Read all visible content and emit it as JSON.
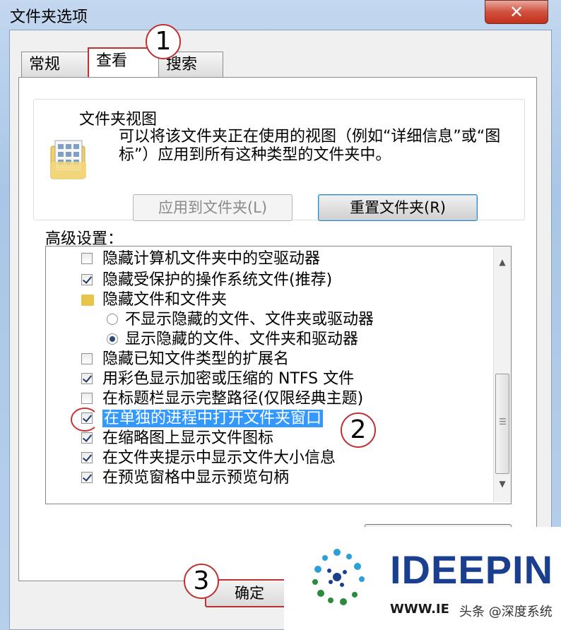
{
  "window": {
    "title": "文件夹选项",
    "close_glyph": "✕"
  },
  "tabs": [
    {
      "label": "常规"
    },
    {
      "label": "查看"
    },
    {
      "label": "搜索"
    }
  ],
  "folder_view": {
    "group_title": "文件夹视图",
    "description": "可以将该文件夹正在使用的视图（例如“详细信息”或“图标”）应用到所有这种类型的文件夹中。",
    "apply_button": "应用到文件夹(L)",
    "reset_button": "重置文件夹(R)"
  },
  "advanced": {
    "label": "高级设置：",
    "items": [
      {
        "type": "checkbox",
        "checked": false,
        "label": "隐藏计算机文件夹中的空驱动器"
      },
      {
        "type": "checkbox",
        "checked": true,
        "label": "隐藏受保护的操作系统文件(推荐)"
      },
      {
        "type": "folder",
        "label": "隐藏文件和文件夹"
      },
      {
        "type": "radio",
        "checked": false,
        "label": "不显示隐藏的文件、文件夹或驱动器"
      },
      {
        "type": "radio",
        "checked": true,
        "label": "显示隐藏的文件、文件夹和驱动器"
      },
      {
        "type": "checkbox",
        "checked": false,
        "label": "隐藏已知文件类型的扩展名"
      },
      {
        "type": "checkbox",
        "checked": true,
        "label": "用彩色显示加密或压缩的 NTFS 文件"
      },
      {
        "type": "checkbox",
        "checked": false,
        "label": "在标题栏显示完整路径(仅限经典主题)"
      },
      {
        "type": "checkbox",
        "checked": true,
        "label": "在单独的进程中打开文件夹窗口",
        "selected": true
      },
      {
        "type": "checkbox",
        "checked": true,
        "label": "在缩略图上显示文件图标"
      },
      {
        "type": "checkbox",
        "checked": true,
        "label": "在文件夹提示中显示文件大小信息"
      },
      {
        "type": "checkbox",
        "checked": true,
        "label": "在预览窗格中显示预览句柄"
      }
    ]
  },
  "ok_button": "确定",
  "annotations": [
    "1",
    "2",
    "3"
  ],
  "watermark": {
    "brand": "IDEEPIN",
    "url": "WWW.IE",
    "author": "头条 @深度系统"
  },
  "colors": {
    "selection": "#3399ff",
    "annotation": "#c03030",
    "brand": "#1a3f8f"
  }
}
